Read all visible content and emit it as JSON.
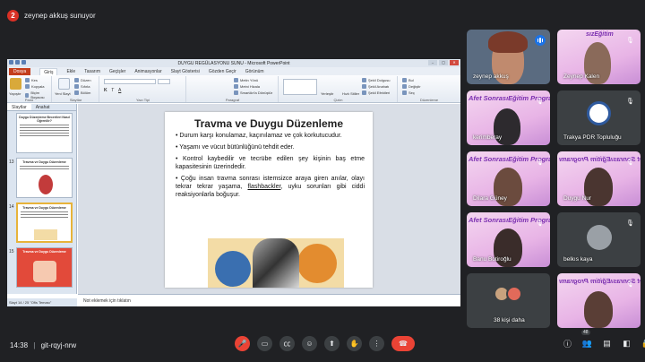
{
  "presenter": {
    "badge": "2",
    "text": "zeynep akkuş sunuyor"
  },
  "window": {
    "title": "DUYGU REGÜLASYONU SUNU - Microsoft PowerPoint",
    "controls": [
      "–",
      "▢",
      "✕"
    ]
  },
  "menu": [
    "Dosya",
    "Giriş",
    "Ekle",
    "Tasarım",
    "Geçişler",
    "Animasyonlar",
    "Slayt Gösterisi",
    "Gözden Geçir",
    "Görünüm"
  ],
  "menu_active": "Giriş",
  "ribbon": {
    "groups": [
      "Pano",
      "Slaytlar",
      "Yazı Tipi",
      "Paragraf",
      "Çizim",
      "Düzenleme"
    ],
    "buttons": [
      "Yapıştır",
      "Kes",
      "Kopyala",
      "Biçim Boyacısı",
      "Yeni Slayt",
      "Düzen",
      "Sıfırla",
      "Bölüm",
      "Metin Yönü",
      "Metni Hizala",
      "SmartArt'a Dönüştür",
      "Yerleştir",
      "Hızlı Stiller",
      "Şekil Dolgusu",
      "Şekil Anahatı",
      "Şekil Efektleri",
      "Bul",
      "Değiştir",
      "Seç"
    ]
  },
  "slides_pane": {
    "tabs": [
      "Slaytlar",
      "Anahat"
    ],
    "thumbs": [
      {
        "num": "",
        "title": "Duygu Düzenleme Becerileri Nasıl Öğrenilir?"
      },
      {
        "num": "13",
        "title": "Travma ve Duygu Düzenleme"
      },
      {
        "num": "14",
        "title": "Travma ve Duygu Düzenleme"
      },
      {
        "num": "15",
        "title": "Travma ve Duygu Düzenleme"
      }
    ]
  },
  "slide": {
    "title": "Travma ve Duygu Düzenleme",
    "bullets": [
      "Durum karşı konulamaz, kaçınılamaz ve çok korkutucudur.",
      "Yaşamı ve vücut bütünlüğünü tehdit eder.",
      "Kontrol kaybedilir ve tecrübe edilen şey kişinin baş etme kapasitesinin üzerindedir.",
      "sonrası istemsizce araya giren anılar, olayı tekrar tekrar yaşama, ",
      "flashbackler",
      ", uyku sorunları gibi ciddi reaksiyonlarla boğuşur."
    ],
    "bullet4_prefix": "Çoğu insan travma "
  },
  "notes_placeholder": "Not eklemek için tıklatın",
  "status": {
    "slide": "Slayt 14 / 25",
    "theme": "\"Ofis Teması\""
  },
  "participants": [
    {
      "name": "zeynep akkuş",
      "speaking": true
    },
    {
      "name": "Zeynep Kalen",
      "banner": "sızEğitim"
    },
    {
      "name": "kerimberay",
      "banner": "Afet SonrasıEğitim Programı"
    },
    {
      "name": "Trakya PDR Topluluğu"
    },
    {
      "name": "Dilara Güney",
      "banner": "Afet SonrasıEğitim Programı"
    },
    {
      "name": "Duygu Nur",
      "banner": "Afet SonrasıEğitim Programı"
    },
    {
      "name": "Banu Botiroğlu",
      "banner": "Afet SonrasıEğitim Programı"
    },
    {
      "name": "belkıs kaya",
      "initial": ""
    },
    {
      "name": "38 kişi daha"
    },
    {
      "name": "",
      "banner": "Afet SonrasıEğitim Programı"
    }
  ],
  "meeting": {
    "time": "14:38",
    "separator": "|",
    "code": "git-rqyj-nrw",
    "people_count": "48"
  },
  "colors": {
    "bg": "#202124",
    "tile": "#3c4043",
    "red": "#ea4335",
    "accent": "#1a73e8"
  }
}
